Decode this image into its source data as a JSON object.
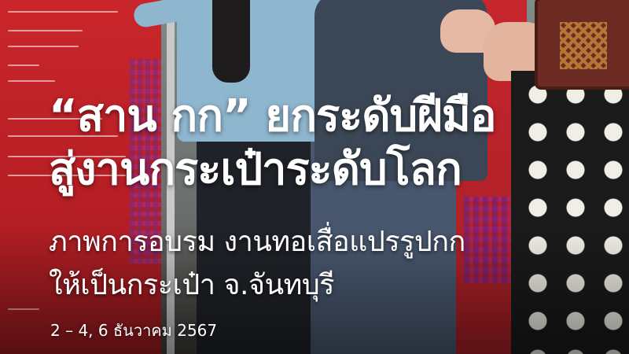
{
  "headline": {
    "line1": "“สาน กก” ยกระดับฝีมือ",
    "line2": "สู่งานกระเป๋าระดับโลก"
  },
  "subheadline": {
    "line1": "ภาพการอบรม งานทอเสื่อแปรรูปกก",
    "line2": "ให้เป็นกระเป๋า จ.จันทบุรี"
  },
  "date": "2 – 4, 6 ธันวาคม 2567",
  "colors": {
    "banner_red": "#c9262b",
    "text": "#ffffff"
  }
}
